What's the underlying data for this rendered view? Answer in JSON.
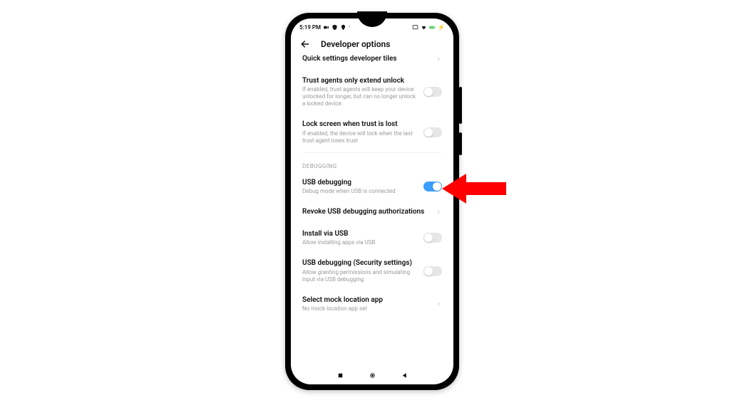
{
  "status": {
    "time": "5:19 PM"
  },
  "header": {
    "title": "Developer options"
  },
  "clipped_row": {
    "title": "Quick settings developer tiles"
  },
  "section_debug": "DEBUGGING",
  "rows": {
    "trust_agents": {
      "title": "Trust agents only extend unlock",
      "sub": "If enabled, trust agents will keep your device unlocked for longer, but can no longer unlock a locked device.",
      "on": false
    },
    "lock_trust": {
      "title": "Lock screen when trust is lost",
      "sub": "If enabled, the device will lock when the last trust agent loses trust",
      "on": false
    },
    "usb_debug": {
      "title": "USB debugging",
      "sub": "Debug mode when USB is connected",
      "on": true
    },
    "revoke": {
      "title": "Revoke USB debugging authorizations"
    },
    "install_usb": {
      "title": "Install via USB",
      "sub": "Allow installing apps via USB",
      "on": false
    },
    "usb_sec": {
      "title": "USB debugging (Security settings)",
      "sub": "Allow granting permissions and simulating input via USB debugging",
      "on": false
    },
    "mock_loc": {
      "title": "Select mock location app",
      "sub": "No mock location app set"
    }
  }
}
